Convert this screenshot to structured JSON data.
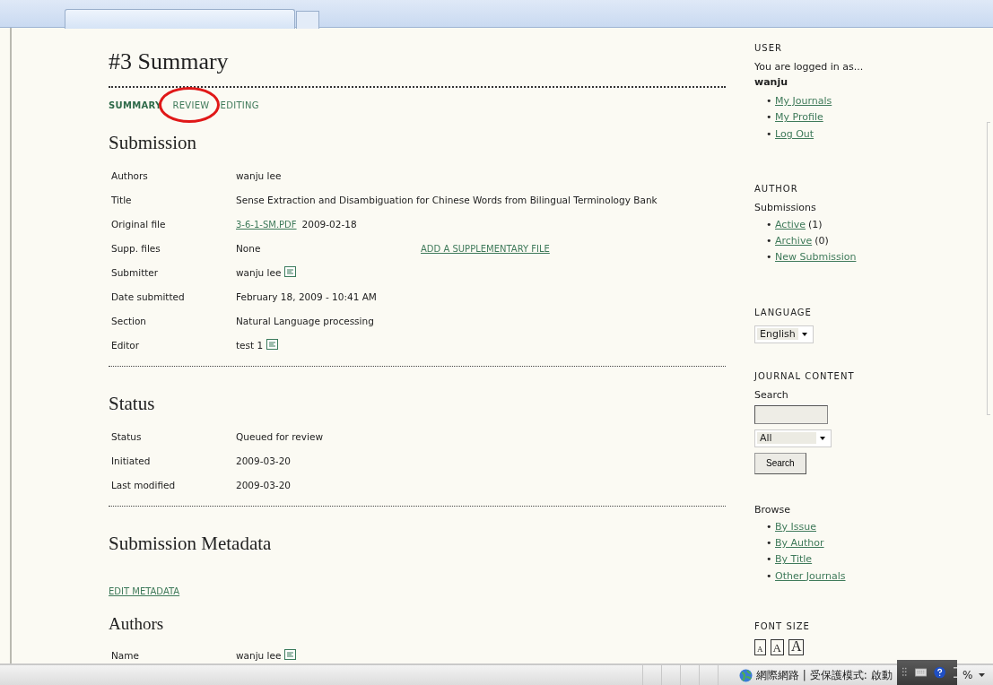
{
  "page_title": "#3 Summary",
  "tabs": [
    {
      "label": "SUMMARY",
      "selected": true,
      "circled": false
    },
    {
      "label": "REVIEW",
      "selected": false,
      "circled": true
    },
    {
      "label": "EDITING",
      "selected": false,
      "circled": false
    }
  ],
  "sections": [
    {
      "heading": "Submission",
      "rows": [
        {
          "label": "Authors",
          "value": "wanju lee"
        },
        {
          "label": "Title",
          "value": "Sense Extraction and Disambiguation for Chinese Words from Bilingual Terminology Bank"
        },
        {
          "label": "Original file",
          "link": "3-6-1-SM.PDF",
          "value": "2009-02-18"
        },
        {
          "label": "Supp. files",
          "value": "None",
          "action": "ADD A SUPPLEMENTARY FILE"
        },
        {
          "label": "Submitter",
          "value": "wanju lee",
          "email_icon": true
        },
        {
          "label": "Date submitted",
          "value": "February 18, 2009 - 10:41 AM"
        },
        {
          "label": "Section",
          "value": "Natural Language processing"
        },
        {
          "label": "Editor",
          "value": "test 1",
          "email_icon": true
        }
      ]
    },
    {
      "heading": "Status",
      "rows": [
        {
          "label": "Status",
          "value": "Queued for review"
        },
        {
          "label": "Initiated",
          "value": "2009-03-20"
        },
        {
          "label": "Last modified",
          "value": "2009-03-20"
        }
      ]
    },
    {
      "heading": "Submission Metadata",
      "link": "EDIT METADATA",
      "subheading": "Authors",
      "rows": [
        {
          "label": "Name",
          "value": "wanju lee",
          "email_icon": true
        }
      ]
    }
  ],
  "sidebar": [
    {
      "heading": "USER",
      "items": [
        {
          "kind": "text",
          "text": "You are logged in as..."
        },
        {
          "kind": "bold",
          "text": "wanju"
        },
        {
          "kind": "links",
          "marker": "•",
          "links": [
            {
              "label": "My Journals"
            },
            {
              "label": "My Profile"
            },
            {
              "label": "Log Out"
            }
          ]
        }
      ]
    },
    {
      "heading": "AUTHOR",
      "items": [
        {
          "kind": "text",
          "text": "Submissions"
        },
        {
          "kind": "links",
          "marker": "•",
          "links": [
            {
              "label": "Active",
              "count": "(1)"
            },
            {
              "label": "Archive",
              "count": "(0)"
            },
            {
              "label": "New Submission"
            }
          ]
        }
      ]
    },
    {
      "heading": "LANGUAGE",
      "items": [
        {
          "kind": "select",
          "value": "English"
        }
      ]
    },
    {
      "heading": "JOURNAL CONTENT",
      "items": [
        {
          "kind": "text",
          "text": "Search"
        },
        {
          "kind": "input"
        },
        {
          "kind": "select",
          "value": "All"
        },
        {
          "kind": "button",
          "text": "Search"
        },
        {
          "kind": "text",
          "text": "Browse"
        },
        {
          "kind": "links",
          "marker": "•",
          "links": [
            {
              "label": "By Issue"
            },
            {
              "label": "By Author"
            },
            {
              "label": "By Title"
            },
            {
              "label": "Other Journals"
            }
          ]
        }
      ]
    },
    {
      "heading": "FONT SIZE",
      "items": [
        {
          "kind": "fontsizes",
          "sizes": [
            {
              "label": "A"
            },
            {
              "label": "A"
            },
            {
              "label": "A"
            }
          ]
        }
      ]
    }
  ],
  "status_bar": {
    "zone": "網際網路 | 受保護模式: 啟動",
    "zoom": "%"
  }
}
